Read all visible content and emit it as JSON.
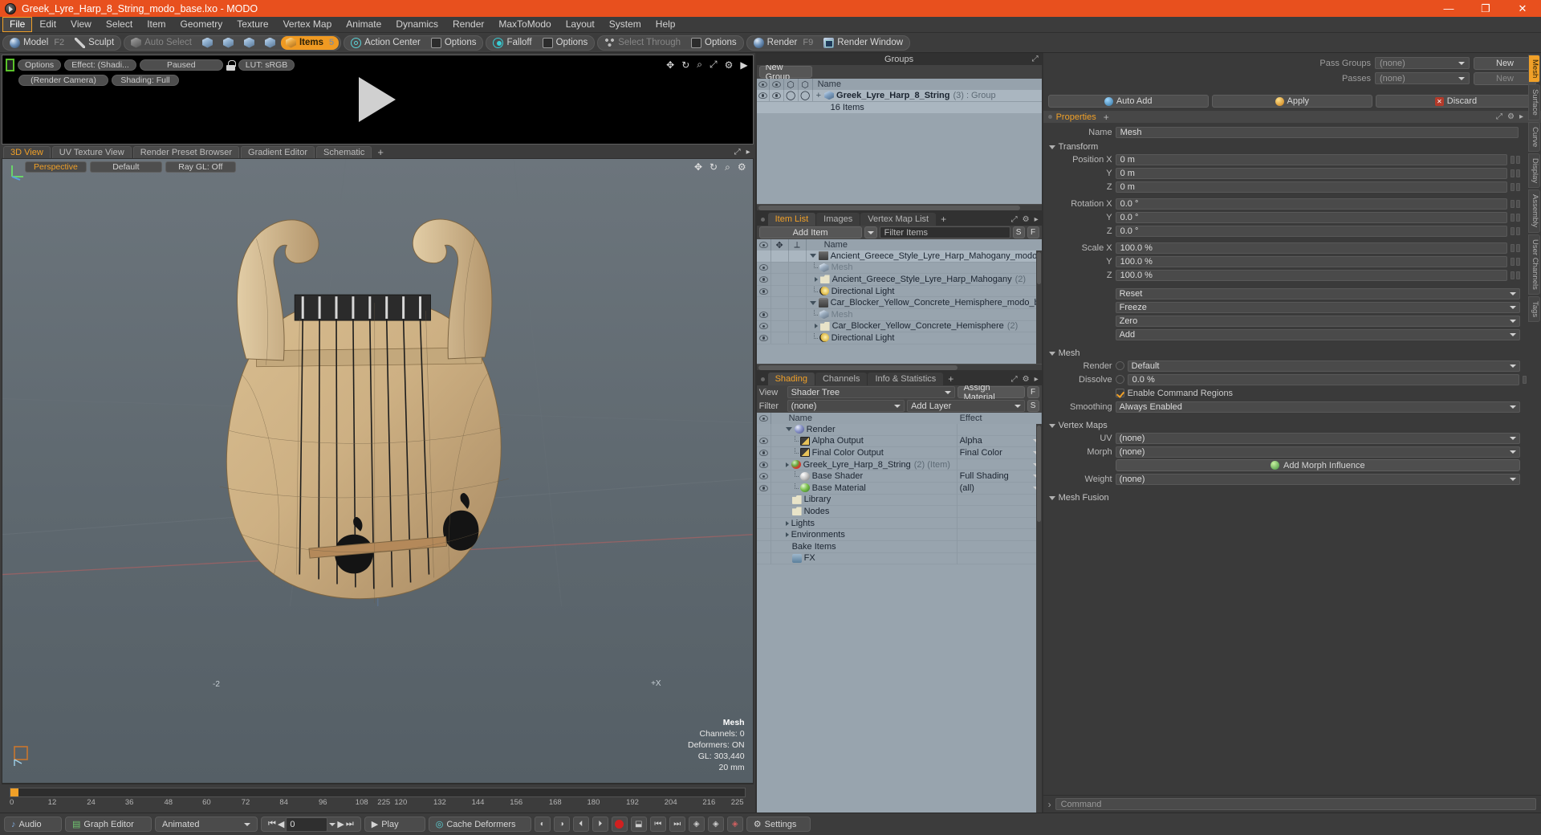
{
  "window": {
    "title": "Greek_Lyre_Harp_8_String_modo_base.lxo - MODO",
    "minimize": "—",
    "maximize": "❐",
    "close": "✕"
  },
  "menu": {
    "items": [
      "File",
      "Edit",
      "View",
      "Select",
      "Item",
      "Geometry",
      "Texture",
      "Vertex Map",
      "Animate",
      "Dynamics",
      "Render",
      "MaxToModo",
      "Layout",
      "System",
      "Help"
    ],
    "active": "File"
  },
  "toolbar": {
    "mode_group": [
      {
        "label": "Model",
        "key": "F2",
        "icon": "sphere-icon"
      },
      {
        "label": "Sculpt",
        "key": "",
        "icon": "pencil-icon"
      }
    ],
    "select_group": [
      {
        "label": "Auto Select",
        "icon": "cube-gray-icon",
        "dim": true
      },
      {
        "label": "",
        "icon": "vertex-icon"
      },
      {
        "label": "",
        "icon": "edge-icon"
      },
      {
        "label": "",
        "icon": "polygon-icon"
      },
      {
        "label": "",
        "icon": "material-icon"
      },
      {
        "label": "Items",
        "icon": "items-icon",
        "count": "5",
        "selected": true
      }
    ],
    "action_center": {
      "label": "Action Center",
      "icon": "target-icon"
    },
    "options1": {
      "label": "Options",
      "icon": "square-icon"
    },
    "falloff": {
      "label": "Falloff",
      "icon": "falloff-icon"
    },
    "options2": {
      "label": "Options",
      "icon": "square-icon"
    },
    "select_through": {
      "label": "Select Through",
      "icon": "dots-icon",
      "dim": true
    },
    "options3": {
      "label": "Options",
      "icon": "square-icon"
    },
    "render": {
      "label": "Render",
      "key": "F9",
      "icon": "sphere-icon"
    },
    "render_window": {
      "label": "Render Window",
      "icon": "render-window-icon"
    }
  },
  "render_preview": {
    "buttons_row1": [
      "Options",
      "Effect: (Shadi...",
      "Paused",
      "LUT: sRGB"
    ],
    "buttons_row2": [
      "(Render Camera)",
      "Shading: Full"
    ],
    "icons": [
      "move-icon",
      "rotate-icon",
      "zoom-icon",
      "fit-icon",
      "gear-icon",
      "play-icon"
    ]
  },
  "viewport_tabs": {
    "tabs": [
      "3D View",
      "UV Texture View",
      "Render Preset Browser",
      "Gradient Editor",
      "Schematic"
    ],
    "active": "3D View",
    "add": "+"
  },
  "viewport": {
    "perspective": "Perspective",
    "shading": "Default",
    "raygl": "Ray GL: Off",
    "icons": [
      "move-icon",
      "rotate-icon",
      "zoom-icon",
      "gear-icon"
    ],
    "axis_minus_z": "-2",
    "axis_plus_x": "+X",
    "hud": {
      "title": "Mesh",
      "channels_label": "Channels:",
      "channels": "0",
      "deformers_label": "Deformers:",
      "deformers": "ON",
      "gl_label": "GL:",
      "gl": "303,440",
      "scale": "20 mm"
    }
  },
  "timeline": {
    "ticks": [
      "0",
      "12",
      "24",
      "36",
      "48",
      "60",
      "72",
      "84",
      "96",
      "108",
      "120",
      "132",
      "144",
      "156",
      "168",
      "180",
      "192",
      "204",
      "216"
    ],
    "current_label": "225",
    "end_label": "225"
  },
  "statusbar": {
    "audio": "Audio",
    "graph_editor": "Graph Editor",
    "animated": "Animated",
    "frame": "0",
    "play": "Play",
    "cache_deformers": "Cache Deformers",
    "settings": "Settings",
    "icons": [
      "audio-icon",
      "graph-icon",
      "prev-key-icon",
      "prev-frame-icon",
      "next-frame-icon",
      "next-key-icon",
      "play-icon",
      "record-icon",
      "settings-icon"
    ]
  },
  "groups_panel": {
    "title": "Groups",
    "new_group_button": "New Group",
    "columns": [
      "eye-icon",
      "texture-icon",
      "render-icon",
      "shade-icon",
      "Name"
    ],
    "rows": [
      {
        "name": "Greek_Lyre_Harp_8_String",
        "count": "(3)",
        "type": ": Group",
        "sub": "16 Items",
        "selected": true
      }
    ]
  },
  "item_list_panel": {
    "tabs": [
      "Item List",
      "Images",
      "Vertex Map List"
    ],
    "active_tab": "Item List",
    "add": "+",
    "add_item_button": "Add Item",
    "filter_placeholder": "Filter Items",
    "filter_buttons": [
      "S",
      "F"
    ],
    "columns": [
      "eye-icon",
      "move-icon",
      "axis-icon",
      "Name"
    ],
    "rows": [
      {
        "indent": 0,
        "icon": "film-icon",
        "name": "Ancient_Greece_Style_Lyre_Harp_Mahogany_modo_base....",
        "count": "",
        "expander": "open",
        "eye": false,
        "selected": true
      },
      {
        "indent": 1,
        "icon": "cube-icon",
        "name": "Mesh",
        "count": "",
        "expander": "",
        "eye": true,
        "dim": true
      },
      {
        "indent": 1,
        "icon": "folder-icon",
        "name": "Ancient_Greece_Style_Lyre_Harp_Mahogany",
        "count": "(2)",
        "expander": "closed",
        "eye": true
      },
      {
        "indent": 1,
        "icon": "light-icon",
        "name": "Directional Light",
        "count": "",
        "expander": "",
        "eye": true
      },
      {
        "indent": 0,
        "icon": "film-icon",
        "name": "Car_Blocker_Yellow_Concrete_Hemisphere_modo_base.lxo",
        "count": "",
        "expander": "open",
        "eye": false
      },
      {
        "indent": 1,
        "icon": "cube-icon",
        "name": "Mesh",
        "count": "",
        "expander": "",
        "eye": true,
        "dim": true
      },
      {
        "indent": 1,
        "icon": "folder-icon",
        "name": "Car_Blocker_Yellow_Concrete_Hemisphere",
        "count": "(2)",
        "expander": "closed",
        "eye": true
      },
      {
        "indent": 1,
        "icon": "light-icon",
        "name": "Directional Light",
        "count": "",
        "expander": "",
        "eye": true
      }
    ]
  },
  "shading_panel": {
    "tabs": [
      "Shading",
      "Channels",
      "Info & Statistics"
    ],
    "active_tab": "Shading",
    "add": "+",
    "view_label": "View",
    "view_value": "Shader Tree",
    "view_filter_button": "F",
    "filter_label": "Filter",
    "filter_value": "(none)",
    "add_layer_value": "Add Layer",
    "assign_material_button": "Assign Material",
    "sidebtn": "S",
    "columns": [
      "eye-icon",
      "Name",
      "Effect"
    ],
    "rows": [
      {
        "indent": 0,
        "icon": "ball-blue-icon",
        "name": "Render",
        "count": "",
        "effect": "",
        "expander": "open",
        "eye": false
      },
      {
        "indent": 1,
        "icon": "image-icon",
        "name": "Alpha Output",
        "count": "",
        "effect": "Alpha",
        "expander": "",
        "eye": true,
        "dd": true
      },
      {
        "indent": 1,
        "icon": "image-icon",
        "name": "Final Color Output",
        "count": "",
        "effect": "Final Color",
        "expander": "",
        "eye": true,
        "dd": true
      },
      {
        "indent": 1,
        "icon": "ball-red-icon",
        "name": "Greek_Lyre_Harp_8_String",
        "count": "(2) (Item)",
        "effect": "",
        "expander": "closed",
        "eye": true,
        "dd": true
      },
      {
        "indent": 1,
        "icon": "ball-gray-icon",
        "name": "Base Shader",
        "count": "",
        "effect": "Full Shading",
        "expander": "",
        "eye": true,
        "dd": true
      },
      {
        "indent": 1,
        "icon": "ball-green-icon",
        "name": "Base Material",
        "count": "",
        "effect": "(all)",
        "expander": "",
        "eye": true,
        "dd": true
      },
      {
        "indent": 0,
        "icon": "folder-icon",
        "name": "Library",
        "count": "",
        "effect": "",
        "expander": "",
        "eye": false
      },
      {
        "indent": 0,
        "icon": "folder-icon",
        "name": "Nodes",
        "count": "",
        "effect": "",
        "expander": "",
        "eye": false
      },
      {
        "indent": 0,
        "icon": "",
        "name": "Lights",
        "count": "",
        "effect": "",
        "expander": "closed",
        "eye": false
      },
      {
        "indent": 0,
        "icon": "",
        "name": "Environments",
        "count": "",
        "effect": "",
        "expander": "closed",
        "eye": false
      },
      {
        "indent": 0,
        "icon": "",
        "name": "Bake Items",
        "count": "",
        "effect": "",
        "expander": "",
        "eye": false
      },
      {
        "indent": 0,
        "icon": "fx-icon",
        "name": "FX",
        "count": "",
        "effect": "",
        "expander": "",
        "eye": false
      }
    ]
  },
  "properties": {
    "pass_groups_label": "Pass Groups",
    "pass_groups_value": "(none)",
    "new_button": "New",
    "passes_label": "Passes",
    "passes_value": "(none)",
    "new_button2": "New",
    "auto_add": "Auto Add",
    "apply": "Apply",
    "discard": "Discard",
    "tab_title": "Properties",
    "tab_add": "+",
    "name_label": "Name",
    "name_value": "Mesh",
    "transform": {
      "title": "Transform",
      "rows": [
        {
          "label": "Position X",
          "value": "0 m"
        },
        {
          "label": "Y",
          "value": "0 m"
        },
        {
          "label": "Z",
          "value": "0 m"
        },
        {
          "label": "Rotation X",
          "value": "0.0 °"
        },
        {
          "label": "Y",
          "value": "0.0 °"
        },
        {
          "label": "Z",
          "value": "0.0 °"
        },
        {
          "label": "Scale X",
          "value": "100.0 %"
        },
        {
          "label": "Y",
          "value": "100.0 %"
        },
        {
          "label": "Z",
          "value": "100.0 %"
        }
      ],
      "actions": [
        "Reset",
        "Freeze",
        "Zero",
        "Add"
      ]
    },
    "mesh": {
      "title": "Mesh",
      "render_label": "Render",
      "render_value": "Default",
      "dissolve_label": "Dissolve",
      "dissolve_value": "0.0 %",
      "enable_command_regions": "Enable Command Regions",
      "enable_checked": true,
      "smoothing_label": "Smoothing",
      "smoothing_value": "Always Enabled"
    },
    "vertex_maps": {
      "title": "Vertex Maps",
      "uv_label": "UV",
      "uv_value": "(none)",
      "morph_label": "Morph",
      "morph_value": "(none)",
      "add_morph_influence": "Add Morph Influence",
      "weight_label": "Weight",
      "weight_value": "(none)"
    },
    "mesh_fusion": {
      "title": "Mesh Fusion"
    },
    "side_tabs": [
      "Mesh",
      "Surface",
      "Curve",
      "Display",
      "Assembly",
      "User Channels",
      "Tags"
    ],
    "side_active": "Mesh"
  },
  "command_bar": {
    "prompt": "›",
    "placeholder": "Command"
  },
  "colors": {
    "accent": "#f0a028",
    "title_bar": "#e8501e",
    "panel_bg": "#3a3a3a",
    "list_bg": "#98a4ae",
    "viewport_bg": "#5e686f"
  }
}
